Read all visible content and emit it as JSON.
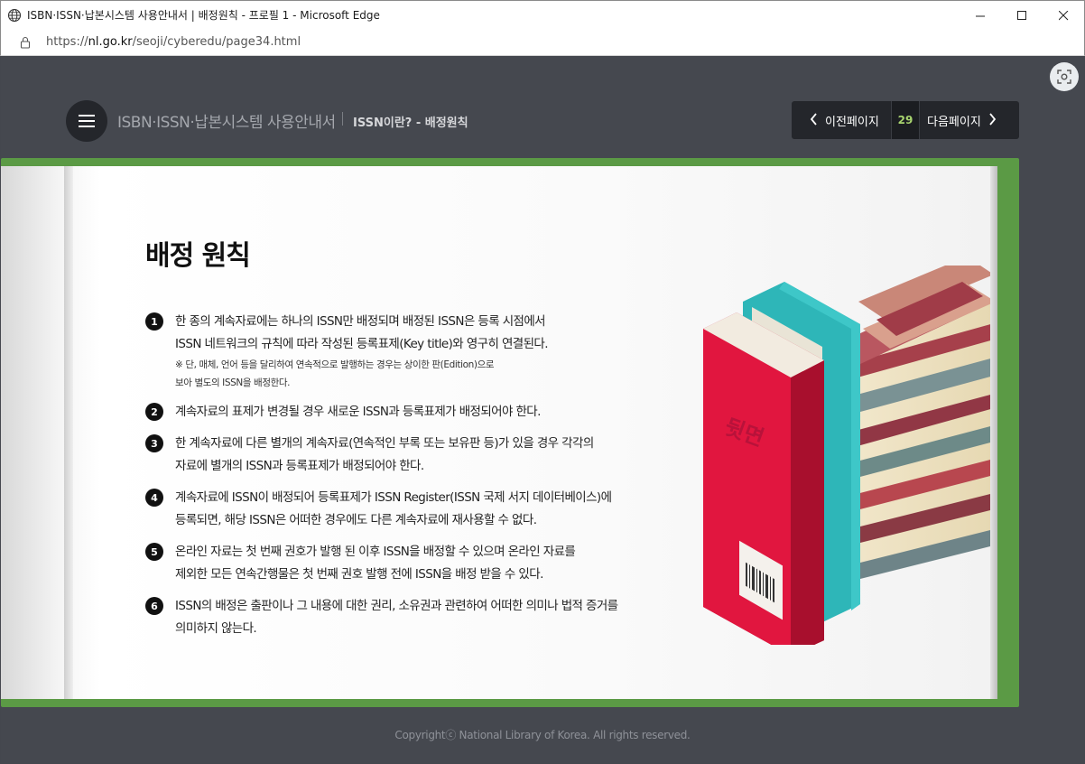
{
  "window": {
    "title": "ISBN·ISSN·납본시스템 사용안내서 | 배정원칙 - 프로필 1 - Microsoft Edge",
    "minimize": "—",
    "maximize": "☐",
    "close": "✕"
  },
  "address": {
    "url_prefix": "https://",
    "url_host": "nl.go.kr",
    "url_path": "/seoji/cyberedu/page34.html"
  },
  "header": {
    "site_title": "ISBN·ISSN·납본시스템 사용안내서",
    "section": "ISSN이란? - 배정원칙"
  },
  "pager": {
    "prev_label": "이전페이지",
    "page_number": "29",
    "next_label": "다음페이지"
  },
  "content": {
    "heading": "배정 원칙",
    "items": [
      {
        "num": "1",
        "lines": [
          "한 종의 계속자료에는 하나의 ISSN만 배정되며 배정된 ISSN은 등록 시점에서",
          "ISSN 네트워크의 규칙에 따라 작성된 등록표제(Key title)와 영구히 연결된다."
        ],
        "notes": [
          "※ 단, 매체, 언어 등을 달리하여 연속적으로 발행하는 경우는 상이한 판(Edition)으로",
          "보아 별도의 ISSN을 배정한다."
        ]
      },
      {
        "num": "2",
        "lines": [
          "계속자료의 표제가 변경될 경우 새로운 ISSN과 등록표제가 배정되어야 한다."
        ],
        "notes": []
      },
      {
        "num": "3",
        "lines": [
          "한 계속자료에 다른 별개의 계속자료(연속적인 부록 또는 보유판 등)가 있을 경우 각각의",
          "자료에 별개의 ISSN과 등록표제가 배정되어야 한다."
        ],
        "notes": []
      },
      {
        "num": "4",
        "lines": [
          "계속자료에 ISSN이 배정되어 등록표제가 ISSN Register(ISSN 국제 서지 데이터베이스)에",
          "등록되면, 해당 ISSN은 어떠한 경우에도 다른 계속자료에 재사용할 수 없다."
        ],
        "notes": []
      },
      {
        "num": "5",
        "lines": [
          "온라인 자료는 첫 번째 권호가 발행 된 이후 ISSN을 배정할 수 있으며 온라인 자료를",
          "제외한 모든 연속간행물은 첫 번째 권호 발행 전에 ISSN을 배정 받을 수 있다."
        ],
        "notes": []
      },
      {
        "num": "6",
        "lines": [
          "ISSN의 배정은 출판이나 그 내용에 대한 권리, 소유권과 관련하여 어떠한 의미나 법적 증거를",
          "의미하지 않는다."
        ],
        "notes": []
      }
    ],
    "book_spine_text": "뒷면"
  },
  "footer": "Copyrightⓒ National Library of Korea. All rights reserved.",
  "colors": {
    "page_bg": "#45484f",
    "book_cover": "#5b9a45",
    "accent_page_num": "#a8d46f"
  }
}
